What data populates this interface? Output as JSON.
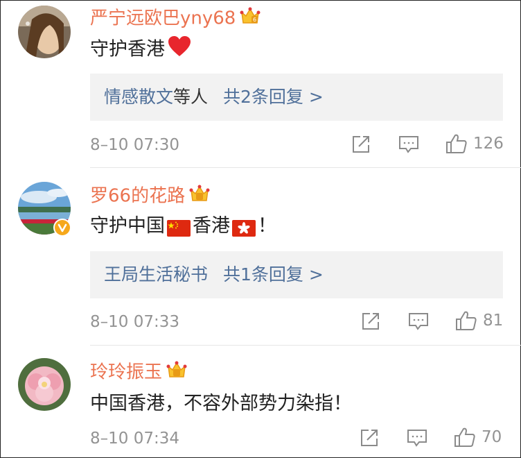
{
  "comments": [
    {
      "username": "严宁远欧巴yny68",
      "text": "守护香港",
      "reply": {
        "names": "情感散文",
        "others": "等人",
        "count": "共2条回复 >"
      },
      "time": "8–10 07:30",
      "likes": "126"
    },
    {
      "username": "罗66的花路",
      "text_parts": [
        "守护中国",
        "香港",
        "！"
      ],
      "reply": {
        "names": "王局生活秘书",
        "count": "共1条回复 >"
      },
      "time": "8–10 07:33",
      "likes": "81"
    },
    {
      "username": "玲玲振玉",
      "text": "中国香港，不容外部势力染指！",
      "time": "8–10 07:34",
      "likes": "70"
    }
  ],
  "colors": {
    "username": "#eb7350",
    "link": "#50709a",
    "meta": "#939393",
    "reply_bg": "#f2f2f2",
    "vip_badge": "#f6a81b"
  },
  "icons": [
    "avatar",
    "vip-crown-icon",
    "heart-emoji",
    "china-flag-emoji",
    "hong-kong-flag-emoji",
    "verified-badge-icon",
    "repost-icon",
    "comment-icon",
    "like-icon"
  ]
}
